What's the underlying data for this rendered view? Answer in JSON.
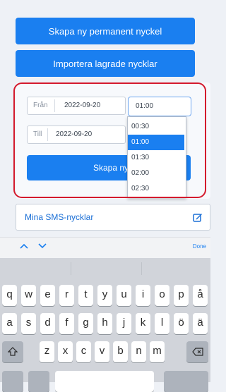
{
  "buttons": {
    "create_permanent": "Skapa ny permanent nyckel",
    "import_saved": "Importera lagrade nycklar",
    "create_new": "Skapa ny n"
  },
  "form": {
    "from_label": "Från",
    "from_date": "2022-09-20",
    "from_time": "01:00",
    "to_label": "Till",
    "to_date": "2022-09-20"
  },
  "dropdown": {
    "options": [
      "00:30",
      "01:00",
      "01:30",
      "02:00",
      "02:30"
    ],
    "selected": "01:00"
  },
  "sms_keys": {
    "label": "Mina SMS-nycklar",
    "edit_icon": "edit-icon"
  },
  "accessory": {
    "done": "Done"
  },
  "keyboard": {
    "row1": [
      "q",
      "w",
      "e",
      "r",
      "t",
      "y",
      "u",
      "i",
      "o",
      "p",
      "å"
    ],
    "row2": [
      "a",
      "s",
      "d",
      "f",
      "g",
      "h",
      "j",
      "k",
      "l",
      "ö",
      "ä"
    ],
    "row3": [
      "z",
      "x",
      "c",
      "v",
      "b",
      "n",
      "m"
    ]
  },
  "colors": {
    "accent": "#1a7ff0",
    "highlight_border": "#d41a2d"
  }
}
